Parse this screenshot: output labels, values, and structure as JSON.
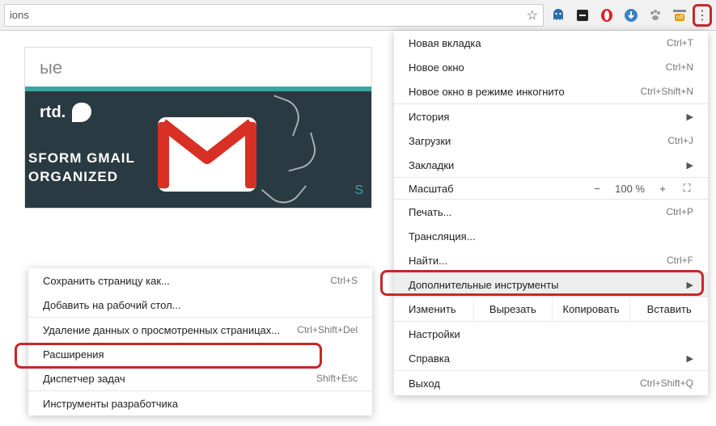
{
  "toolbar": {
    "url_fragment": "ions",
    "star_icon": "☆"
  },
  "ext_icons": [
    "ghost",
    "screen",
    "opera",
    "download",
    "paw",
    "translate"
  ],
  "panel": {
    "heading_fragment": "ые"
  },
  "banner": {
    "brand": "rtd.",
    "line1": "SFORM GMAIL",
    "line2": "ORGANIZED",
    "cta_fragment": "S"
  },
  "menu": {
    "new_tab": "Новая вкладка",
    "new_tab_sc": "Ctrl+T",
    "new_window": "Новое окно",
    "new_window_sc": "Ctrl+N",
    "incognito": "Новое окно в режиме инкогнито",
    "incognito_sc": "Ctrl+Shift+N",
    "history": "История",
    "downloads": "Загрузки",
    "downloads_sc": "Ctrl+J",
    "bookmarks": "Закладки",
    "zoom_label": "Масштаб",
    "zoom_minus": "−",
    "zoom_value": "100 %",
    "zoom_plus": "+",
    "fullscreen_icon": "⛶",
    "print": "Печать...",
    "print_sc": "Ctrl+P",
    "cast": "Трансляция...",
    "find": "Найти...",
    "find_sc": "Ctrl+F",
    "more_tools": "Дополнительные инструменты",
    "edit_label": "Изменить",
    "cut": "Вырезать",
    "copy": "Копировать",
    "paste": "Вставить",
    "settings": "Настройки",
    "help": "Справка",
    "exit": "Выход",
    "exit_sc": "Ctrl+Shift+Q"
  },
  "submenu": {
    "save_as": "Сохранить страницу как...",
    "save_as_sc": "Ctrl+S",
    "add_desktop": "Добавить на рабочий стол...",
    "clear_data": "Удаление данных о просмотренных страницах...",
    "clear_data_sc": "Ctrl+Shift+Del",
    "extensions": "Расширения",
    "task_manager": "Диспетчер задач",
    "task_manager_sc": "Shift+Esc",
    "dev_tools": "Инструменты разработчика"
  }
}
